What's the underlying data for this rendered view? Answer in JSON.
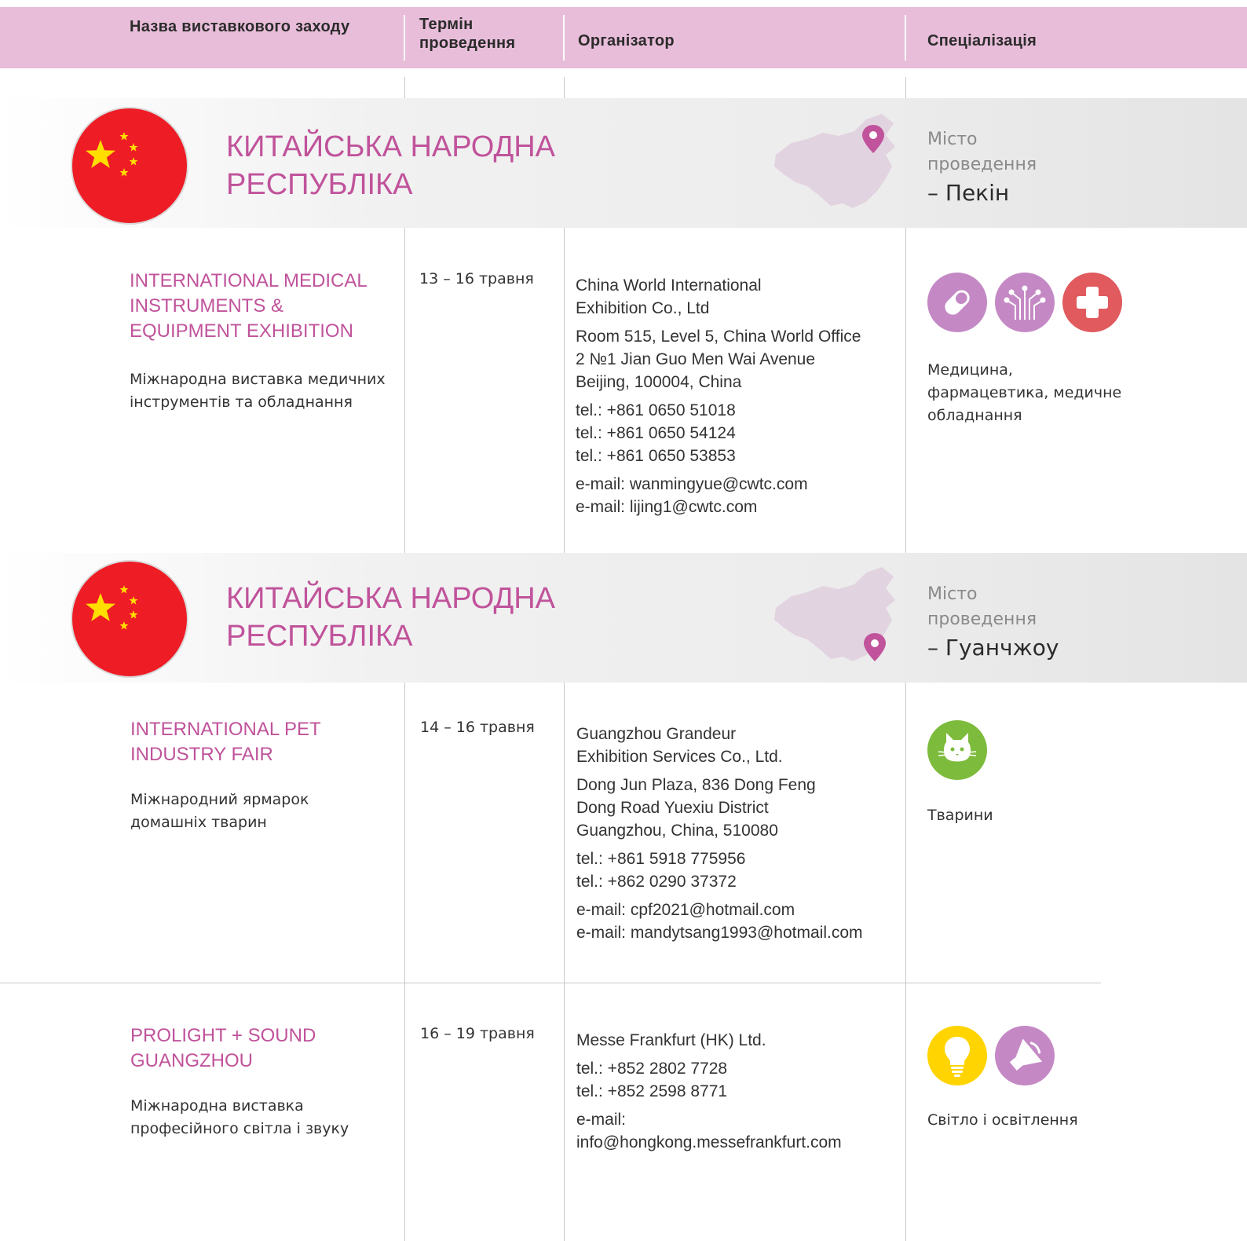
{
  "header": {
    "col_name": "Назва виставкового заходу",
    "col_date": "Термін проведення",
    "col_org": "Організатор",
    "col_spec": "Спеціалізація"
  },
  "sections": [
    {
      "country": "КИТАЙСЬКА НАРОДНА РЕСПУБЛІКА",
      "city_label": "Місто проведення",
      "city": "– Пекін"
    },
    {
      "country": "КИТАЙСЬКА НАРОДНА РЕСПУБЛІКА",
      "city_label": "Місто проведення",
      "city": "– Гуанчжоу"
    }
  ],
  "events": [
    {
      "name_en": "INTERNATIONAL MEDICAL INSTRUMENTS & EQUIPMENT EXHIBITION",
      "name_ua": "Міжнародна виставка медичних інструментів та обладнання",
      "date": "13 – 16 травня",
      "org_name": [
        "China World International",
        "Exhibition Co., Ltd"
      ],
      "address": [
        "Room 515, Level 5, China World Office",
        "2 №1 Jian Guo Men Wai Avenue",
        "Beijing, 100004, China"
      ],
      "phones": [
        "tel.: +861 0650 51018",
        "tel.: +861 0650 54124",
        "tel.: +861 0650 53853"
      ],
      "emails": [
        "e-mail: wanmingyue@cwtc.com",
        "e-mail: lijing1@cwtc.com"
      ],
      "spec": "Медицина, фармацевтика, медичне обладнання",
      "icons": [
        "pill-icon",
        "circuit-icon",
        "medical-cross-icon"
      ]
    },
    {
      "name_en": "INTERNATIONAL PET INDUSTRY FAIR",
      "name_ua": "Міжнародний ярмарок домашніх тварин",
      "date": "14 – 16 травня",
      "org_name": [
        "Guangzhou Grandeur",
        "Exhibition Services Co., Ltd."
      ],
      "address": [
        "Dong Jun Plaza, 836 Dong Feng",
        "Dong Road Yuexiu District",
        "Guangzhou, China, 510080"
      ],
      "phones": [
        "tel.: +861 5918 775956",
        "tel.: +862 0290 37372"
      ],
      "emails": [
        "e-mail: cpf2021@hotmail.com",
        "e-mail: mandytsang1993@hotmail.com"
      ],
      "spec": "Тварини",
      "icons": [
        "cat-icon"
      ]
    },
    {
      "name_en": "PROLIGHT + SOUND GUANGZHOU",
      "name_ua": "Міжнародна виставка професійного світла і звуку",
      "date": "16 – 19 травня",
      "org_name": [
        "Messe Frankfurt (HK) Ltd."
      ],
      "phones": [
        "tel.: +852 2802 7728",
        "tel.: +852 2598 8771"
      ],
      "emails": [
        "e-mail:",
        "info@hongkong.messefrankfurt.com"
      ],
      "spec": "Світло і освітлення",
      "icons": [
        "light-bulb-icon",
        "speaker-icon"
      ]
    }
  ],
  "colors": {
    "header_bg": "#e8bdd9",
    "accent_pink": "#c0539b",
    "icon_purple": "#c489c5",
    "icon_red": "#e05a5e",
    "icon_green": "#7dbb3c",
    "icon_yellow": "#ffd400",
    "flag_red": "#ee1c25",
    "flag_star": "#ffde00"
  }
}
